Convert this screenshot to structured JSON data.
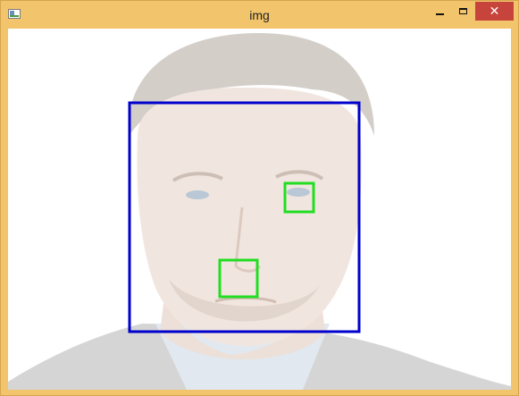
{
  "window": {
    "title": "img",
    "close_glyph": "✕"
  },
  "icons": [
    "app-icon",
    "minimize-icon",
    "maximize-icon",
    "close-icon"
  ],
  "colors": {
    "titlebar": "#f2c46b",
    "close_button": "#c7443c",
    "face_box": "#0000cc",
    "feature_box": "#22dd22"
  },
  "image": {
    "description_kind": "photo",
    "detections": [
      {
        "label": "",
        "type": "face",
        "color": "#0000cc"
      },
      {
        "label": "",
        "type": "eye",
        "color": "#22dd22"
      },
      {
        "label": "",
        "type": "nose",
        "color": "#22dd22"
      }
    ]
  }
}
